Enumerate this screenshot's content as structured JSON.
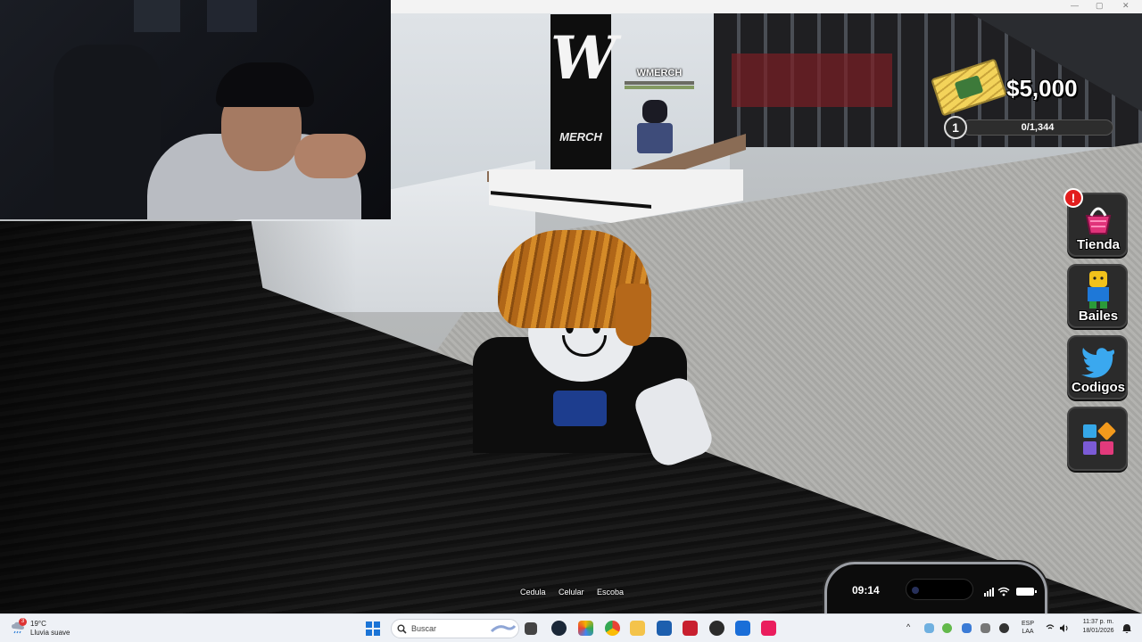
{
  "game": {
    "store_sign": {
      "logo_letter": "W",
      "word": "MERCH"
    },
    "npc": {
      "name": "WMERCH"
    },
    "hud": {
      "money": "$5,000",
      "level": "1",
      "xp_text": "0/1,344",
      "xp_progress": 0.0,
      "alert": "!",
      "side_buttons": [
        {
          "label": "Tienda",
          "icon": "shopping-basket-icon"
        },
        {
          "label": "Bailes",
          "icon": "dance-character-icon"
        },
        {
          "label": "Codigos",
          "icon": "twitter-bird-icon"
        },
        {
          "label": "",
          "icon": "apps-grid-icon"
        }
      ]
    },
    "hotbar": [
      "Cedula",
      "Celular",
      "Escoba"
    ],
    "phone": {
      "time": "09:14"
    }
  },
  "taskbar": {
    "weather": {
      "temp": "19°C",
      "desc": "Lluvia suave",
      "badge": "3"
    },
    "search_placeholder": "Buscar",
    "language": {
      "line1": "ESP",
      "line2": "LAA"
    },
    "clock": {
      "time": "11:37 p. m.",
      "date": "18/01/2026"
    },
    "colors": {
      "start": "#1b74d6",
      "accent_red": "#e21d1d"
    }
  }
}
